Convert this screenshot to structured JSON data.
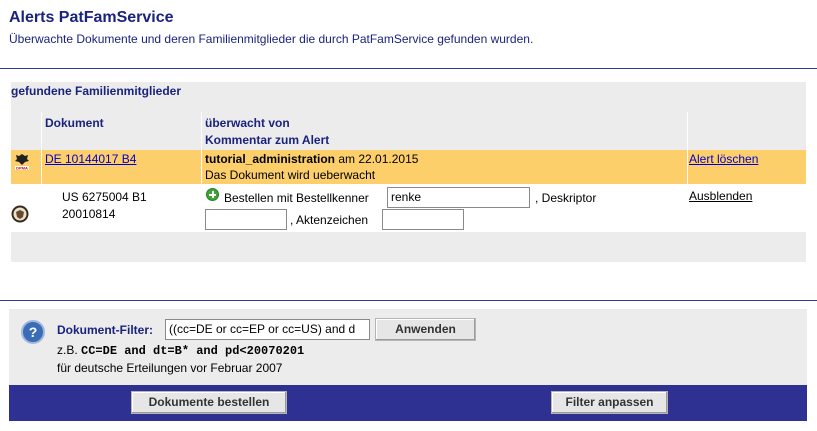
{
  "header": {
    "title": "Alerts PatFamService",
    "subtitle": "Überwachte Dokumente und deren Familienmitglieder die durch PatFamService gefunden wurden."
  },
  "section": {
    "title": "gefundene Familienmitglieder"
  },
  "table": {
    "col_document": "Dokument",
    "col_watched_by": "überwacht von",
    "col_comment": "Kommentar zum Alert",
    "row1": {
      "document": "DE 10144017 B4",
      "user": "tutorial_administration",
      "date_text": " am 22.01.2015",
      "comment": "Das Dokument wird ueberwacht",
      "action": "Alert löschen"
    },
    "row2": {
      "document": "US 6275004 B1",
      "date": "20010814",
      "order_label": "Bestellen mit Bestellkenner",
      "order_value": "renke",
      "descriptor_label": ", Deskriptor",
      "descriptor_value": "",
      "fileref_label": ", Aktenzeichen",
      "fileref_value": "",
      "action": "Ausblenden"
    }
  },
  "filter": {
    "label": "Dokument-Filter:",
    "value": "((cc=DE or cc=EP or cc=US) and d",
    "apply": "Anwenden",
    "example_prefix": "z.B. ",
    "example_code": "CC=DE and dt=B* and pd<20070201",
    "example_desc": "für deutsche Erteilungen vor Februar 2007"
  },
  "footer": {
    "order_button": "Dokumente bestellen",
    "adjust_button": "Filter anpassen"
  },
  "icons": {
    "row1": "dpma-logo-icon",
    "row2": "uspto-seal-icon",
    "order": "plus-icon",
    "help": "help-icon"
  },
  "colors": {
    "accent": "#1a237e",
    "highlight_row": "#fccf6a",
    "footer_bar": "#2e3192",
    "panel": "#ececec"
  }
}
